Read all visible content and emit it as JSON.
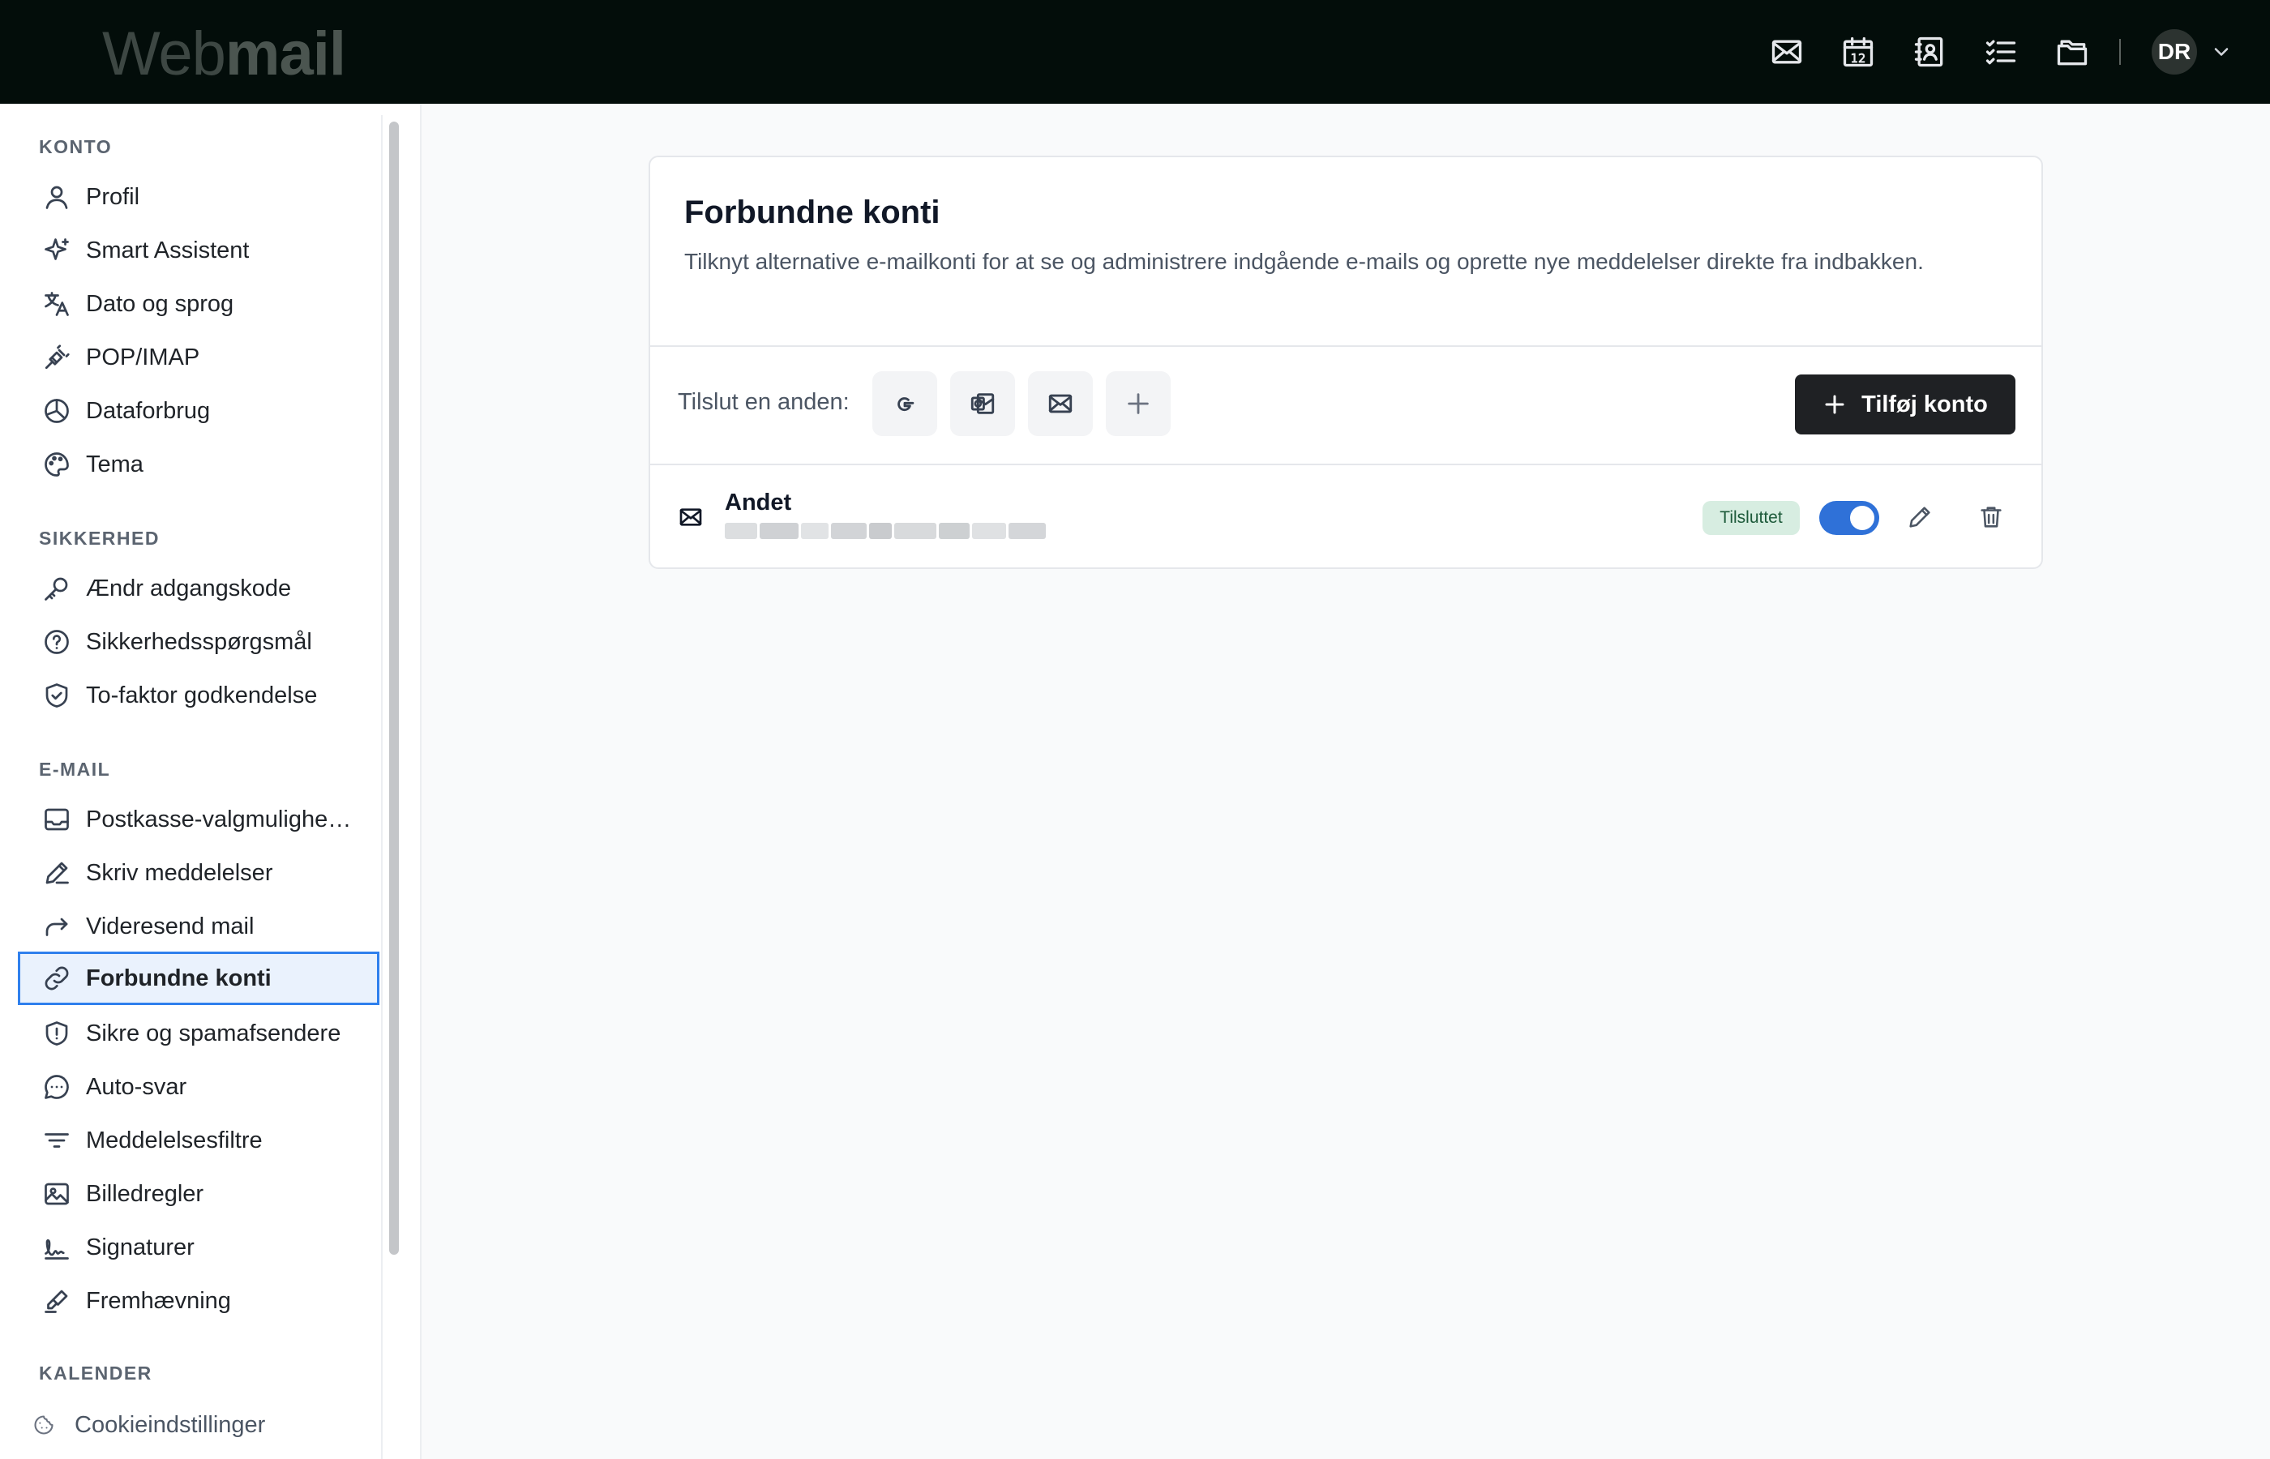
{
  "header": {
    "logo_part1": "Web",
    "logo_part2": "mail",
    "nav_icons": [
      "mail-icon",
      "calendar-icon",
      "contacts-icon",
      "tasks-icon",
      "files-icon"
    ],
    "calendar_day": "12",
    "avatar_initials": "DR"
  },
  "sidebar": {
    "sections": {
      "account": "KONTO",
      "security": "SIKKERHED",
      "email": "E-MAIL",
      "calendar": "KALENDER"
    },
    "items": [
      {
        "label": "Profil",
        "icon": "user-icon"
      },
      {
        "label": "Smart Assistent",
        "icon": "sparkles-icon"
      },
      {
        "label": "Dato og sprog",
        "icon": "translate-icon"
      },
      {
        "label": "POP/IMAP",
        "icon": "plug-icon"
      },
      {
        "label": "Dataforbrug",
        "icon": "pie-chart-icon"
      },
      {
        "label": "Tema",
        "icon": "palette-icon"
      },
      {
        "label": "Ændr adgangskode",
        "icon": "key-icon"
      },
      {
        "label": "Sikkerhedsspørgsmål",
        "icon": "question-circle-icon"
      },
      {
        "label": "To-faktor godkendelse",
        "icon": "shield-check-icon"
      },
      {
        "label": "Postkasse-valgmuligheder",
        "icon": "inbox-icon"
      },
      {
        "label": "Skriv meddelelser",
        "icon": "pencil-icon"
      },
      {
        "label": "Videresend mail",
        "icon": "forward-icon"
      },
      {
        "label": "Forbundne konti",
        "icon": "link-icon"
      },
      {
        "label": "Sikre og spamafsendere",
        "icon": "shield-alert-icon"
      },
      {
        "label": "Auto-svar",
        "icon": "chat-bubble-icon"
      },
      {
        "label": "Meddelelsesfiltre",
        "icon": "filter-icon"
      },
      {
        "label": "Billedregler",
        "icon": "image-icon"
      },
      {
        "label": "Signaturer",
        "icon": "signature-icon"
      },
      {
        "label": "Fremhævning",
        "icon": "highlighter-icon"
      }
    ],
    "active_item": "Forbundne konti",
    "cookie_label": "Cookieindstillinger"
  },
  "main": {
    "title": "Forbundne konti",
    "description": "Tilknyt alternative e-mailkonti for at se og administrere indgående e-mails og oprette nye meddelelser direkte fra indbakken.",
    "connect_label": "Tilslut en anden:",
    "providers": [
      "google-icon",
      "outlook-icon",
      "mail-icon",
      "plus-icon"
    ],
    "add_account_label": "Tilføj konto",
    "accounts": [
      {
        "name": "Andet",
        "status": "Tilsluttet",
        "enabled": true
      }
    ]
  },
  "colors": {
    "topbar": "#030d0a",
    "accent": "#2f80ed",
    "toggle_on": "#2f71d8",
    "badge_bg": "#d7ede1"
  }
}
